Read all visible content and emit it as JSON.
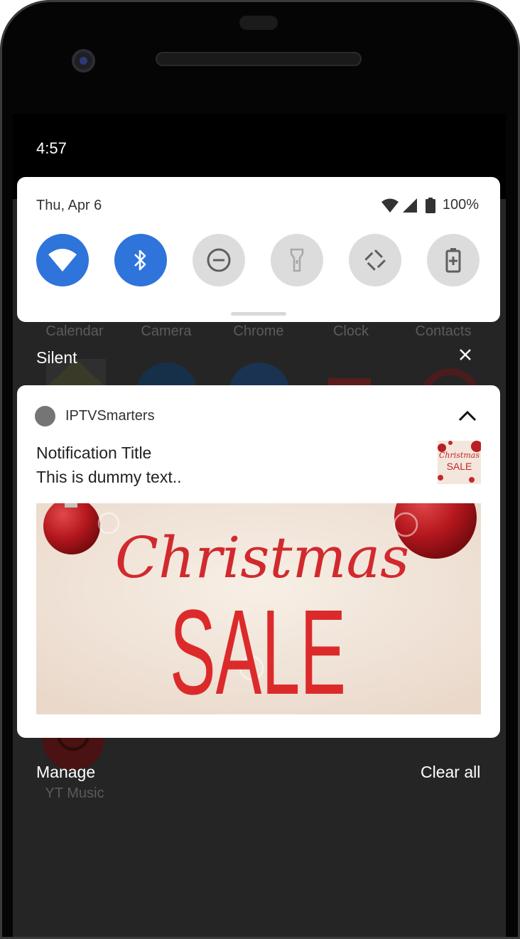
{
  "status_bar": {
    "time": "4:57"
  },
  "launcher": {
    "apps": [
      "Calendar",
      "Camera",
      "Chrome",
      "Clock",
      "Contacts"
    ],
    "yt_label": "YT Music"
  },
  "quick_settings": {
    "date": "Thu, Apr 6",
    "battery": "100%",
    "tiles": [
      {
        "icon": "wifi-icon",
        "state": "on"
      },
      {
        "icon": "bluetooth-icon",
        "state": "on"
      },
      {
        "icon": "do-not-disturb-icon",
        "state": "off"
      },
      {
        "icon": "flashlight-icon",
        "state": "off"
      },
      {
        "icon": "auto-rotate-icon",
        "state": "off"
      },
      {
        "icon": "battery-saver-icon",
        "state": "off"
      }
    ]
  },
  "section": {
    "label": "Silent"
  },
  "notification": {
    "app_name": "IPTVSmarters",
    "title": "Notification Title",
    "text": "This is dummy text..",
    "image": {
      "script_text": "Christmas",
      "sale_text": "SALE",
      "thumb_script": "Christmas",
      "thumb_sale": "SALE"
    }
  },
  "footer": {
    "manage": "Manage",
    "clear_all": "Clear all"
  },
  "colors": {
    "accent": "#2f74db",
    "sale_red": "#d8262b",
    "panel": "#ffffff",
    "shade": "#252525"
  }
}
